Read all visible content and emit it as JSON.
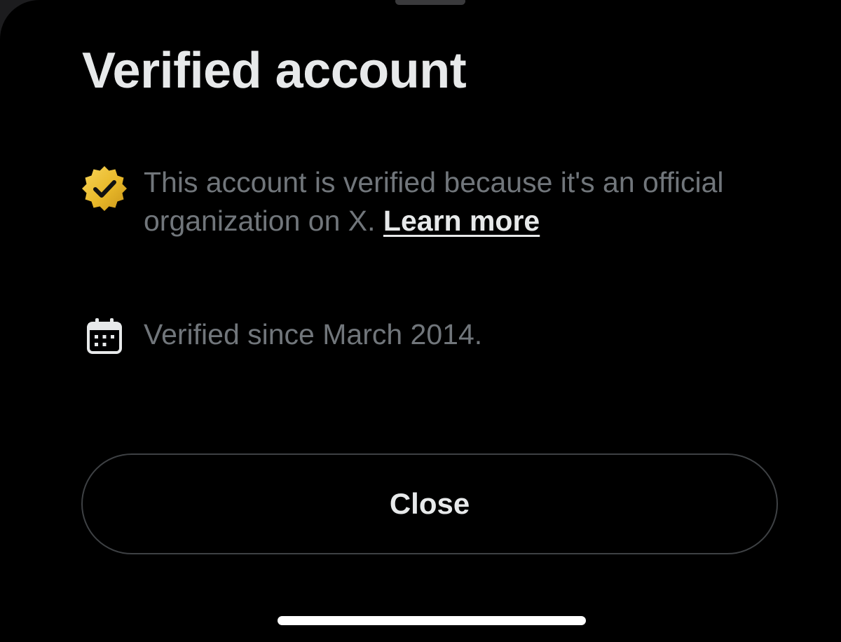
{
  "sheet": {
    "title": "Verified account"
  },
  "verification": {
    "description": "This account is verified because it's an official organization on X.",
    "learn_more_label": "Learn more",
    "badge_icon": "gold-verified-badge-icon",
    "badge_color": "#e8b829"
  },
  "verified_since": {
    "text": "Verified since March 2014.",
    "icon": "calendar-icon"
  },
  "actions": {
    "close_label": "Close"
  },
  "colors": {
    "background": "#000000",
    "primary_text": "#e7e9ea",
    "secondary_text": "#71767b",
    "button_border": "#3e4144"
  }
}
